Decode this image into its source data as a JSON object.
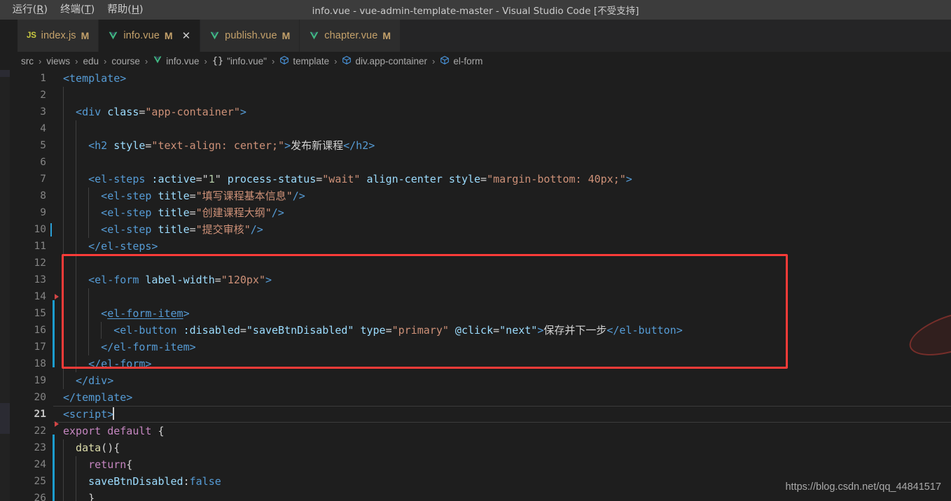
{
  "window": {
    "title": "info.vue - vue-admin-template-master - Visual Studio Code [不受支持]",
    "menus": [
      {
        "pre": ")",
        "label": "",
        "accel": ""
      },
      {
        "pre": "运行(",
        "label": "R",
        "accel": ")"
      },
      {
        "pre": "终端(",
        "label": "T",
        "accel": ")"
      },
      {
        "pre": "帮助(",
        "label": "H",
        "accel": ")"
      }
    ]
  },
  "tabs": [
    {
      "icon": "js-icon",
      "name": "index.js",
      "badge": "M",
      "active": false,
      "closable": false
    },
    {
      "icon": "vue-icon",
      "name": "info.vue",
      "badge": "M",
      "active": true,
      "closable": true
    },
    {
      "icon": "vue-icon",
      "name": "publish.vue",
      "badge": "M",
      "active": false,
      "closable": false
    },
    {
      "icon": "vue-icon",
      "name": "chapter.vue",
      "badge": "M",
      "active": false,
      "closable": false
    }
  ],
  "breadcrumbs": [
    {
      "icon": "",
      "label": "src"
    },
    {
      "icon": "",
      "label": "views"
    },
    {
      "icon": "",
      "label": "edu"
    },
    {
      "icon": "",
      "label": "course"
    },
    {
      "icon": "vue-icon",
      "label": "info.vue"
    },
    {
      "icon": "json-icon",
      "label": "\"info.vue\""
    },
    {
      "icon": "cube-icon",
      "label": "template"
    },
    {
      "icon": "cube-icon",
      "label": "div.app-container"
    },
    {
      "icon": "cube-icon",
      "label": "el-form"
    }
  ],
  "editor": {
    "separator": "›",
    "active_line": 21,
    "lines": [
      {
        "n": 1,
        "indent": 0,
        "tokens": [
          {
            "c": "t-tag",
            "t": "<template>"
          }
        ]
      },
      {
        "n": 2,
        "indent": 1,
        "tokens": []
      },
      {
        "n": 3,
        "indent": 1,
        "tokens": [
          {
            "c": "t-tag",
            "t": "<div "
          },
          {
            "c": "t-attr",
            "t": "class"
          },
          {
            "c": "t-plain",
            "t": "="
          },
          {
            "c": "t-str",
            "t": "\"app-container\""
          },
          {
            "c": "t-tag",
            "t": ">"
          }
        ]
      },
      {
        "n": 4,
        "indent": 2,
        "tokens": []
      },
      {
        "n": 5,
        "indent": 2,
        "tokens": [
          {
            "c": "t-tag",
            "t": "<h2 "
          },
          {
            "c": "t-attr",
            "t": "style"
          },
          {
            "c": "t-plain",
            "t": "="
          },
          {
            "c": "t-str",
            "t": "\"text-align: center;\""
          },
          {
            "c": "t-tag",
            "t": ">"
          },
          {
            "c": "t-cjk",
            "t": "发布新课程"
          },
          {
            "c": "t-tag",
            "t": "</h2>"
          }
        ]
      },
      {
        "n": 6,
        "indent": 2,
        "tokens": []
      },
      {
        "n": 7,
        "indent": 2,
        "tokens": [
          {
            "c": "t-tag",
            "t": "<el-steps "
          },
          {
            "c": "t-attr",
            "t": ":active"
          },
          {
            "c": "t-plain",
            "t": "="
          },
          {
            "c": "t-plain",
            "t": "\""
          },
          {
            "c": "t-num",
            "t": "1"
          },
          {
            "c": "t-plain",
            "t": "\" "
          },
          {
            "c": "t-attr",
            "t": "process-status"
          },
          {
            "c": "t-plain",
            "t": "="
          },
          {
            "c": "t-str",
            "t": "\"wait\""
          },
          {
            "c": "t-plain",
            "t": " "
          },
          {
            "c": "t-attr",
            "t": "align-center"
          },
          {
            "c": "t-plain",
            "t": " "
          },
          {
            "c": "t-attr",
            "t": "style"
          },
          {
            "c": "t-plain",
            "t": "="
          },
          {
            "c": "t-str",
            "t": "\"margin-bottom: 40px;\""
          },
          {
            "c": "t-tag",
            "t": ">"
          }
        ]
      },
      {
        "n": 8,
        "indent": 3,
        "tokens": [
          {
            "c": "t-tag",
            "t": "<el-step "
          },
          {
            "c": "t-attr",
            "t": "title"
          },
          {
            "c": "t-plain",
            "t": "="
          },
          {
            "c": "t-str",
            "t": "\""
          },
          {
            "c": "t-str t-cjk2",
            "t": "填写课程基本信息"
          },
          {
            "c": "t-str",
            "t": "\""
          },
          {
            "c": "t-tag",
            "t": "/>"
          }
        ]
      },
      {
        "n": 9,
        "indent": 3,
        "tokens": [
          {
            "c": "t-tag",
            "t": "<el-step "
          },
          {
            "c": "t-attr",
            "t": "title"
          },
          {
            "c": "t-plain",
            "t": "="
          },
          {
            "c": "t-str",
            "t": "\""
          },
          {
            "c": "t-str t-cjk2",
            "t": "创建课程大纲"
          },
          {
            "c": "t-str",
            "t": "\""
          },
          {
            "c": "t-tag",
            "t": "/>"
          }
        ]
      },
      {
        "n": 10,
        "indent": 3,
        "tokens": [
          {
            "c": "t-tag",
            "t": "<el-step "
          },
          {
            "c": "t-attr",
            "t": "title"
          },
          {
            "c": "t-plain",
            "t": "="
          },
          {
            "c": "t-str",
            "t": "\""
          },
          {
            "c": "t-str t-cjk2",
            "t": "提交审核"
          },
          {
            "c": "t-str",
            "t": "\""
          },
          {
            "c": "t-tag",
            "t": "/>"
          }
        ]
      },
      {
        "n": 11,
        "indent": 2,
        "tokens": [
          {
            "c": "t-tag",
            "t": "</el-steps>"
          }
        ]
      },
      {
        "n": 12,
        "indent": 2,
        "tokens": []
      },
      {
        "n": 13,
        "indent": 2,
        "tokens": [
          {
            "c": "t-tag",
            "t": "<el-form "
          },
          {
            "c": "t-attr",
            "t": "label-width"
          },
          {
            "c": "t-plain",
            "t": "="
          },
          {
            "c": "t-str",
            "t": "\"120px\""
          },
          {
            "c": "t-tag",
            "t": ">"
          }
        ]
      },
      {
        "n": 14,
        "indent": 3,
        "tokens": []
      },
      {
        "n": 15,
        "indent": 3,
        "tokens": [
          {
            "c": "t-tag",
            "t": "<"
          },
          {
            "c": "t-tag t-link",
            "t": "el-form-item"
          },
          {
            "c": "t-tag",
            "t": ">"
          }
        ]
      },
      {
        "n": 16,
        "indent": 4,
        "tokens": [
          {
            "c": "t-tag",
            "t": "<el-button "
          },
          {
            "c": "t-attr",
            "t": ":disabled"
          },
          {
            "c": "t-plain",
            "t": "="
          },
          {
            "c": "t-attr",
            "t": "\"saveBtnDisabled\""
          },
          {
            "c": "t-plain",
            "t": " "
          },
          {
            "c": "t-attr",
            "t": "type"
          },
          {
            "c": "t-plain",
            "t": "="
          },
          {
            "c": "t-str",
            "t": "\"primary\""
          },
          {
            "c": "t-plain",
            "t": " "
          },
          {
            "c": "t-attr",
            "t": "@click"
          },
          {
            "c": "t-plain",
            "t": "="
          },
          {
            "c": "t-attr",
            "t": "\"next\""
          },
          {
            "c": "t-tag",
            "t": ">"
          },
          {
            "c": "t-cjk",
            "t": "保存并下一步"
          },
          {
            "c": "t-tag",
            "t": "</el-button>"
          }
        ]
      },
      {
        "n": 17,
        "indent": 3,
        "tokens": [
          {
            "c": "t-tag",
            "t": "</el-form-item>"
          }
        ]
      },
      {
        "n": 18,
        "indent": 2,
        "tokens": [
          {
            "c": "t-tag",
            "t": "</el-form>"
          }
        ]
      },
      {
        "n": 19,
        "indent": 1,
        "tokens": [
          {
            "c": "t-tag",
            "t": "</div>"
          }
        ]
      },
      {
        "n": 20,
        "indent": 0,
        "tokens": [
          {
            "c": "t-tag",
            "t": "</template>"
          }
        ]
      },
      {
        "n": 21,
        "indent": 0,
        "tokens": [
          {
            "c": "t-tag",
            "t": "<script>"
          }
        ],
        "cursor": true
      },
      {
        "n": 22,
        "indent": 0,
        "tokens": [
          {
            "c": "t-kw",
            "t": "export"
          },
          {
            "c": "t-plain",
            "t": " "
          },
          {
            "c": "t-kw",
            "t": "default"
          },
          {
            "c": "t-plain",
            "t": " {"
          }
        ]
      },
      {
        "n": 23,
        "indent": 1,
        "tokens": [
          {
            "c": "t-fn",
            "t": "data"
          },
          {
            "c": "t-plain",
            "t": "(){"
          }
        ]
      },
      {
        "n": 24,
        "indent": 2,
        "tokens": [
          {
            "c": "t-kw",
            "t": "return"
          },
          {
            "c": "t-plain",
            "t": "{"
          }
        ]
      },
      {
        "n": 25,
        "indent": 2,
        "tokens": [
          {
            "c": "t-attr",
            "t": "saveBtnDisabled"
          },
          {
            "c": "t-plain",
            "t": ":"
          },
          {
            "c": "t-tag",
            "t": "false"
          }
        ]
      },
      {
        "n": 26,
        "indent": 2,
        "tokens": [
          {
            "c": "t-plain",
            "t": "}"
          }
        ]
      }
    ]
  },
  "annotation": {
    "redbox_label": "highlighted-code-region",
    "color": "#f93b38"
  },
  "watermark": {
    "text": "https://blog.csdn.net/qq_44841517"
  }
}
